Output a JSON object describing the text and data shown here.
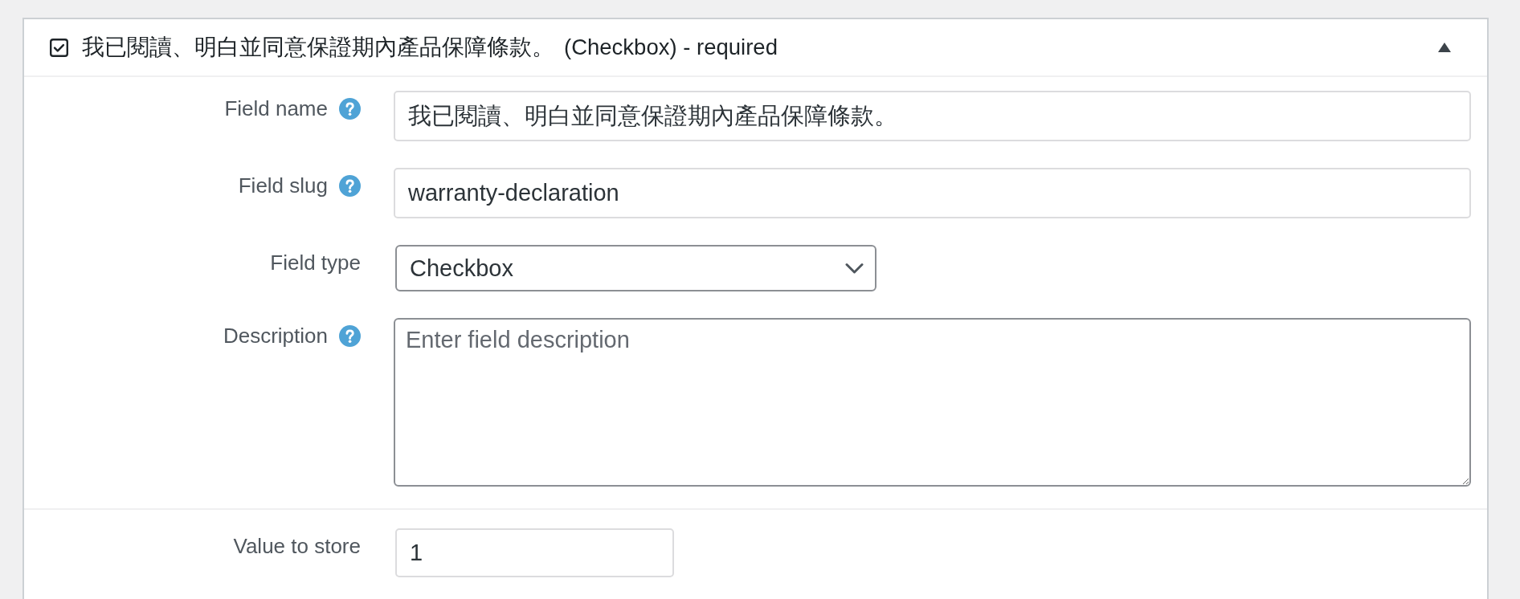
{
  "field_panel": {
    "title": "我已閱讀、明白並同意保證期內產品保障條款。",
    "type_note": "(Checkbox) - required",
    "expanded": true,
    "fields": [
      {
        "kind": "text",
        "label": "Field name",
        "help": true,
        "value": "我已閱讀、明白並同意保證期內產品保障條款。"
      },
      {
        "kind": "text",
        "label": "Field slug",
        "help": true,
        "value": "warranty-declaration"
      },
      {
        "kind": "select",
        "label": "Field type",
        "help": false,
        "value": "Checkbox"
      },
      {
        "kind": "textarea",
        "label": "Description",
        "help": true,
        "placeholder": "Enter field description"
      }
    ],
    "extra_fields": [
      {
        "kind": "short-text",
        "label": "Value to store",
        "help": false,
        "value": "1"
      }
    ]
  }
}
